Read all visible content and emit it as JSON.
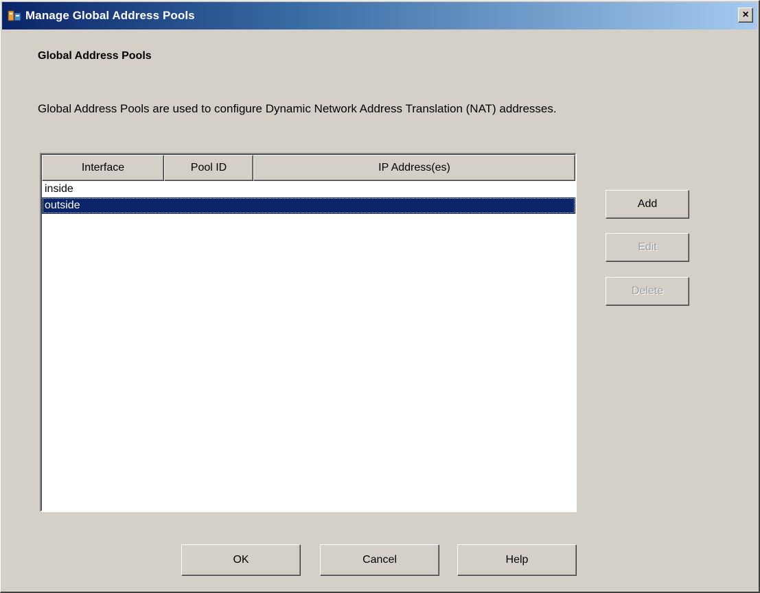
{
  "window": {
    "title": "Manage Global Address Pools",
    "icon": "app-icon",
    "close_label": "×"
  },
  "section_title": "Global Address Pools",
  "description": "Global Address Pools are used to configure Dynamic Network Address Translation (NAT) addresses.",
  "table": {
    "columns": [
      "Interface",
      "Pool ID",
      "IP Address(es)"
    ],
    "rows": [
      {
        "interface": "inside",
        "pool_id": "",
        "ip_addresses": "",
        "selected": false
      },
      {
        "interface": "outside",
        "pool_id": "",
        "ip_addresses": "",
        "selected": true
      }
    ]
  },
  "side_buttons": {
    "add": "Add",
    "edit": "Edit",
    "delete": "Delete"
  },
  "bottom_buttons": {
    "ok": "OK",
    "cancel": "Cancel",
    "help": "Help"
  },
  "colors": {
    "selection": "#0a246a",
    "dialog_bg": "#d4d0c8"
  }
}
